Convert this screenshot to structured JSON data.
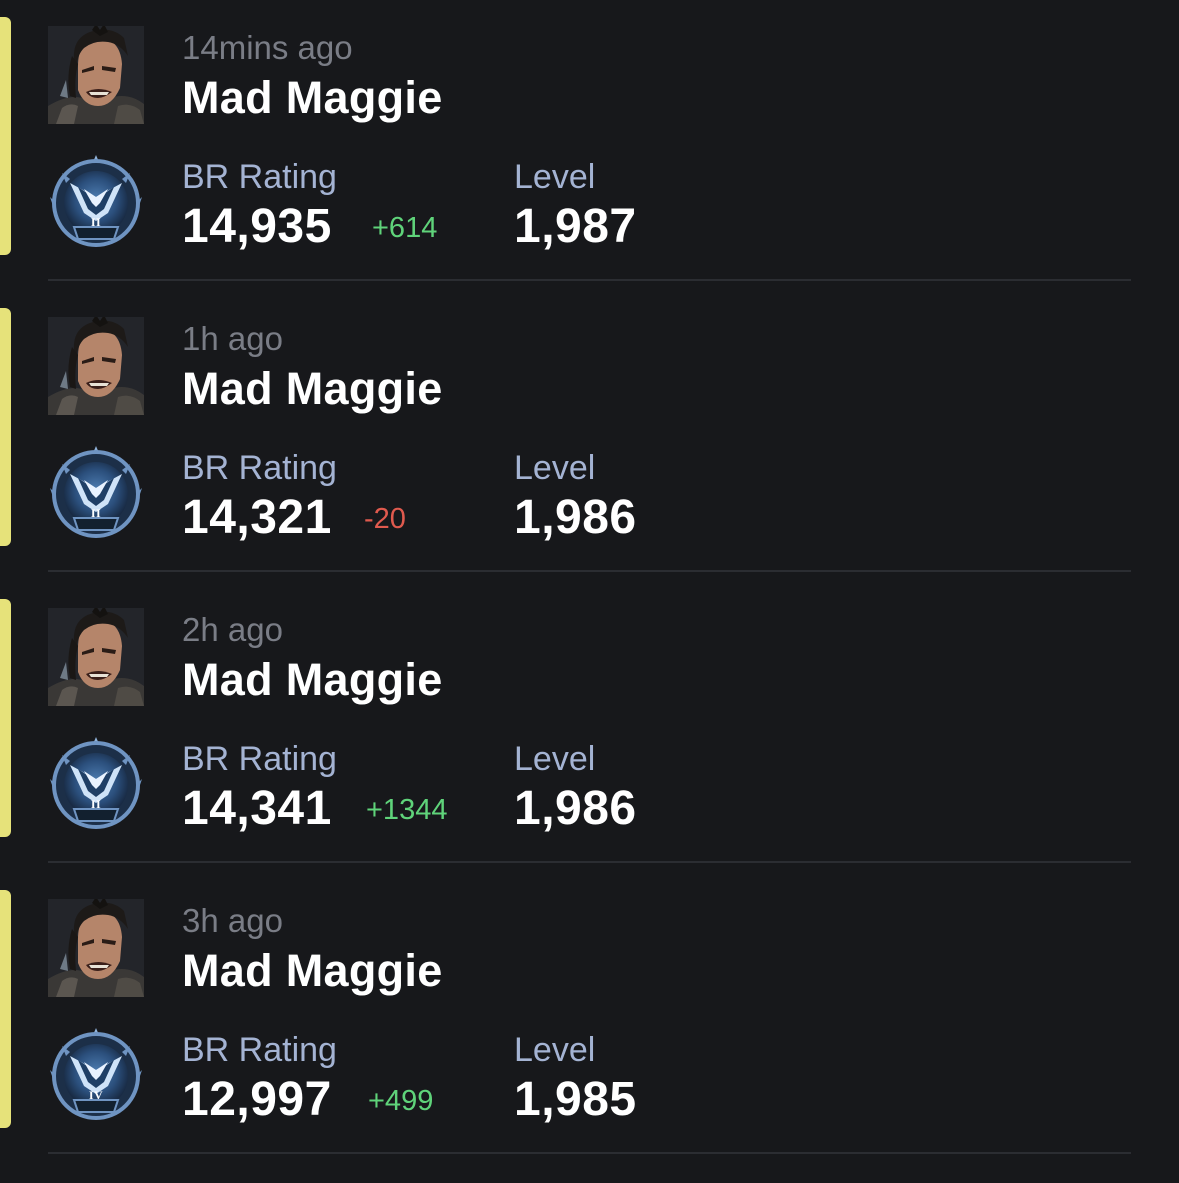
{
  "colors": {
    "background": "#17181b",
    "accent_bar": "#e6e27a",
    "positive_delta": "#5fd37a",
    "negative_delta": "#e05a4e",
    "label": "#a4b3d3",
    "timestamp": "#7a7d86"
  },
  "labels": {
    "br_rating": "BR Rating",
    "level": "Level"
  },
  "matches": [
    {
      "time_ago": "14mins ago",
      "legend": "Mad Maggie",
      "rank_tier": "II",
      "br_rating": "14,935",
      "rating_change": "+614",
      "rating_change_sign": "positive",
      "level": "1,987"
    },
    {
      "time_ago": "1h ago",
      "legend": "Mad Maggie",
      "rank_tier": "II",
      "br_rating": "14,321",
      "rating_change": "-20",
      "rating_change_sign": "negative",
      "level": "1,986"
    },
    {
      "time_ago": "2h ago",
      "legend": "Mad Maggie",
      "rank_tier": "II",
      "br_rating": "14,341",
      "rating_change": "+1344",
      "rating_change_sign": "positive",
      "level": "1,986"
    },
    {
      "time_ago": "3h ago",
      "legend": "Mad Maggie",
      "rank_tier": "IV",
      "br_rating": "12,997",
      "rating_change": "+499",
      "rating_change_sign": "positive",
      "level": "1,985"
    }
  ]
}
